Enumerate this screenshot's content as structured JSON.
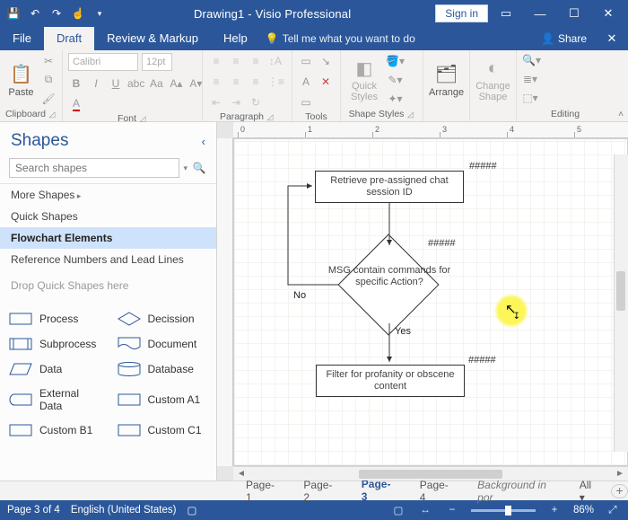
{
  "titlebar": {
    "doc_title": "Drawing1  -  Visio Professional",
    "signin": "Sign in",
    "qat": [
      "save",
      "undo",
      "redo",
      "touch",
      "dropdown"
    ]
  },
  "menubar": {
    "file": "File",
    "tabs": [
      "Draft",
      "Review & Markup",
      "Help"
    ],
    "active_tab": "Draft",
    "tellme_placeholder": "Tell me what you want to do",
    "share": "Share"
  },
  "ribbon": {
    "clipboard": {
      "label": "Clipboard",
      "paste": "Paste"
    },
    "font": {
      "label": "Font",
      "name_placeholder": "Calibri",
      "size_placeholder": "12pt"
    },
    "paragraph": {
      "label": "Paragraph"
    },
    "tools": {
      "label": "Tools"
    },
    "shapestyles": {
      "label": "Shape Styles",
      "quick": "Quick Styles"
    },
    "arrange": {
      "label": "Arrange"
    },
    "change": {
      "label": "Change Shape"
    },
    "editing": {
      "label": "Editing"
    }
  },
  "shapes_panel": {
    "title": "Shapes",
    "search_placeholder": "Search shapes",
    "stencils": [
      {
        "label": "More Shapes",
        "more": true
      },
      {
        "label": "Quick Shapes"
      },
      {
        "label": "Flowchart Elements",
        "selected": true
      },
      {
        "label": "Reference Numbers and Lead Lines"
      }
    ],
    "drop_hint": "Drop Quick Shapes here",
    "shape_grid": [
      [
        {
          "name": "Process",
          "icon": "rect"
        },
        {
          "name": "Decission",
          "icon": "diamond"
        }
      ],
      [
        {
          "name": "Subprocess",
          "icon": "subproc"
        },
        {
          "name": "Document",
          "icon": "doc"
        }
      ],
      [
        {
          "name": "Data",
          "icon": "data"
        },
        {
          "name": "Database",
          "icon": "db"
        }
      ],
      [
        {
          "name": "External Data",
          "icon": "extdata"
        },
        {
          "name": "Custom A1",
          "icon": "rect"
        }
      ],
      [
        {
          "name": "Custom B1",
          "icon": "rect"
        },
        {
          "name": "Custom C1",
          "icon": "rect"
        }
      ]
    ]
  },
  "canvas": {
    "ruler_ticks": [
      "0",
      "1",
      "2",
      "3",
      "4",
      "5"
    ],
    "nodes": {
      "n1": "Retrieve pre-assigned chat session ID",
      "n2": "MSG contain commands for specific Action?",
      "n3": "Filter for profanity or obscene content"
    },
    "hash": "#####",
    "edge_no": "No",
    "edge_yes": "Yes"
  },
  "pagetabs": {
    "tabs": [
      "Page-1",
      "Page-2",
      "Page-3",
      "Page-4"
    ],
    "active": "Page-3",
    "background": "Background in por",
    "all": "All"
  },
  "statusbar": {
    "page": "Page 3 of 4",
    "lang": "English (United States)",
    "record": "",
    "zoom": "86%"
  }
}
